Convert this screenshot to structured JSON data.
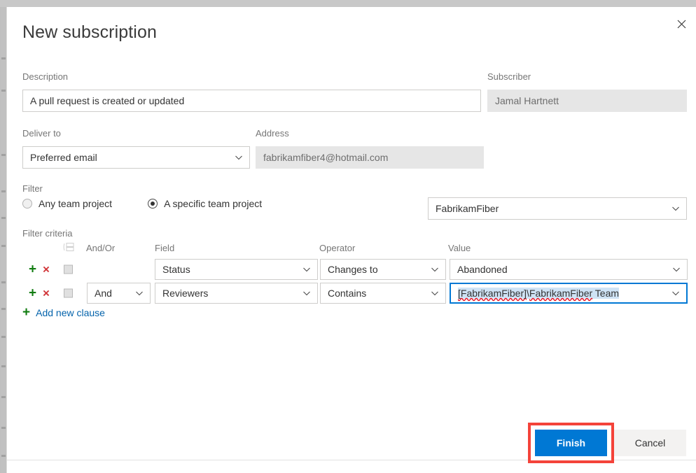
{
  "dialog": {
    "title": "New subscription",
    "close_icon": "close-icon"
  },
  "description": {
    "label": "Description",
    "value": "A pull request is created or updated"
  },
  "subscriber": {
    "label": "Subscriber",
    "value": "Jamal Hartnett",
    "disabled": true
  },
  "deliver_to": {
    "label": "Deliver to",
    "value": "Preferred email"
  },
  "address": {
    "label": "Address",
    "value": "fabrikamfiber4@hotmail.com",
    "disabled": true
  },
  "filter": {
    "label": "Filter",
    "options": [
      {
        "label": "Any team project",
        "selected": false
      },
      {
        "label": "A specific team project",
        "selected": true
      }
    ],
    "project": "FabrikamFiber"
  },
  "filter_criteria": {
    "label": "Filter criteria",
    "headers": {
      "list_icon": "list-grid-icon",
      "andor": "And/Or",
      "field": "Field",
      "operator": "Operator",
      "value": "Value"
    },
    "rows": [
      {
        "add_icon": "+",
        "delete_icon": "×",
        "andor": "",
        "field": "Status",
        "operator": "Changes to",
        "value": "Abandoned",
        "focused": false
      },
      {
        "add_icon": "+",
        "delete_icon": "×",
        "andor": "And",
        "field": "Reviewers",
        "operator": "Contains",
        "value": "[FabrikamFiber]\\FabrikamFiber Team",
        "value_part_1": "[FabrikamFiber]",
        "value_part_2": "\\",
        "value_part_3": "FabrikamFiber",
        "value_part_4": " Team",
        "focused": true
      }
    ],
    "add_clause": {
      "icon": "+",
      "label": "Add new clause"
    }
  },
  "footer": {
    "finish_label": "Finish",
    "cancel_label": "Cancel"
  },
  "colors": {
    "accent": "#0078d4",
    "add": "#107c10",
    "delete": "#d13438",
    "link": "#0463ab",
    "annotation": "#f4433a",
    "selection": "#cfe3f5",
    "spellcheck": "#e81123"
  }
}
